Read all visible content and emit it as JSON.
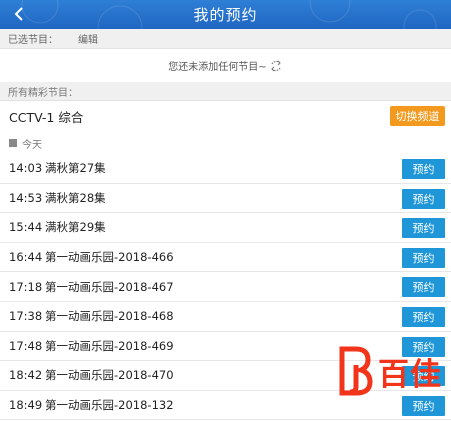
{
  "header": {
    "title": "我的预约",
    "back_icon": "chevron-left-icon"
  },
  "selected": {
    "label": "已选节目：",
    "edit_label": "编辑"
  },
  "empty": {
    "message": "您还未添加任何节目~",
    "icon": "refresh-icon"
  },
  "all_programs": {
    "label": "所有精彩节目："
  },
  "channel": {
    "name": "CCTV-1 综合",
    "switch_label": "切换频道"
  },
  "day": {
    "label": "今天"
  },
  "programs": [
    {
      "time": "14:03",
      "name": "满秋第27集",
      "action": "预约"
    },
    {
      "time": "14:53",
      "name": "满秋第28集",
      "action": "预约"
    },
    {
      "time": "15:44",
      "name": "满秋第29集",
      "action": "预约"
    },
    {
      "time": "16:44",
      "name": "第一动画乐园-2018-466",
      "action": "预约"
    },
    {
      "time": "17:18",
      "name": "第一动画乐园-2018-467",
      "action": "预约"
    },
    {
      "time": "17:38",
      "name": "第一动画乐园-2018-468",
      "action": "预约"
    },
    {
      "time": "17:48",
      "name": "第一动画乐园-2018-469",
      "action": "预约"
    },
    {
      "time": "18:42",
      "name": "第一动画乐园-2018-470",
      "action": "预约"
    },
    {
      "time": "18:49",
      "name": "第一动画乐园-2018-132",
      "action": "预约"
    }
  ],
  "watermark": {
    "text": "百佳",
    "colors": {
      "accent": "#f2341b"
    }
  },
  "colors": {
    "header": "#2573cc",
    "switch_button": "#f39a1e",
    "reserve_button": "#1e96d8"
  }
}
